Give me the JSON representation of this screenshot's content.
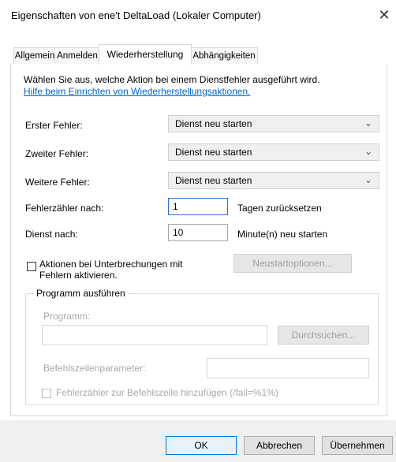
{
  "window": {
    "title": "Eigenschaften von ene't DeltaLoad (Lokaler Computer)",
    "close_glyph": "✕"
  },
  "tabs": [
    {
      "label": "Allgemein",
      "active": false
    },
    {
      "label": "Anmelden",
      "active": false
    },
    {
      "label": "Wiederherstellung",
      "active": true
    },
    {
      "label": "Abhängigkeiten",
      "active": false
    }
  ],
  "recovery": {
    "intro": "Wählen Sie aus, welche Aktion bei einem Dienstfehler ausgeführt wird.",
    "help_link": "Hilfe beim Einrichten von Wiederherstellungsaktionen.",
    "first_failure": {
      "label": "Erster Fehler:",
      "value": "Dienst neu starten"
    },
    "second_failure": {
      "label": "Zweiter Fehler:",
      "value": "Dienst neu starten"
    },
    "subsequent_failures": {
      "label": "Weitere Fehler:",
      "value": "Dienst neu starten"
    },
    "reset_count": {
      "label": "Fehlerzähler nach:",
      "value": "1",
      "suffix": "Tagen zurücksetzen"
    },
    "restart_after": {
      "label": "Dienst nach:",
      "value": "10",
      "suffix": "Minute(n) neu starten"
    },
    "enable_actions": {
      "line1": "Aktionen bei Unterbrechungen mit",
      "line2": "Fehlern aktivieren.",
      "checked": false
    },
    "restart_options_button": "Neustartoptionen..."
  },
  "run_program": {
    "legend": "Programm ausführen",
    "program_label": "Programm:",
    "program_value": "",
    "browse_button": "Durchsuchen...",
    "params_label": "Befehlszeilenparameter:",
    "params_value": "",
    "append_fail_count": "Fehlerzähler zur Befehlszeile hinzufügen (/fail=%1%)"
  },
  "footer": {
    "ok": "OK",
    "cancel": "Abbrechen",
    "apply": "Übernehmen"
  },
  "colors": {
    "link": "#0066cc",
    "focus_border": "#2b6fd6",
    "disabled_text": "#a8a8a8"
  }
}
